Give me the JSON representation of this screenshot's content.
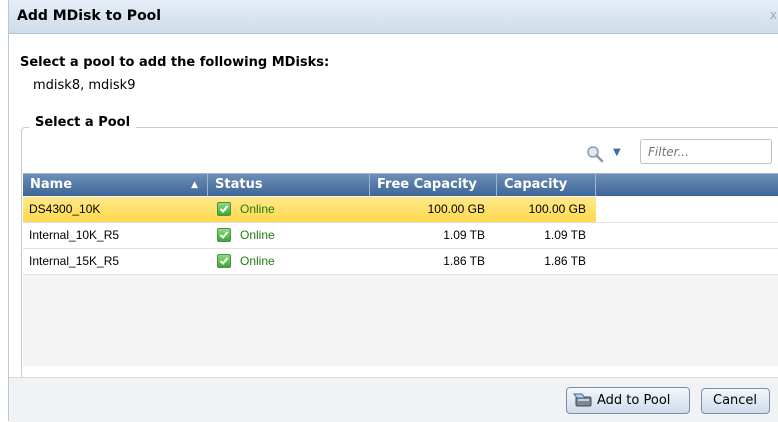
{
  "dialog": {
    "title": "Add MDisk to Pool",
    "close_glyph": "x",
    "heading": "Select a pool to add the following MDisks:",
    "mdisks": "mdisk8, mdisk9",
    "section_label": "Select a Pool"
  },
  "toolbar": {
    "search_icon": "magnifier-icon",
    "filter_placeholder": "Filter..."
  },
  "table": {
    "columns": [
      "Name",
      "Status",
      "Free Capacity",
      "Capacity"
    ],
    "sort": {
      "column": "Name",
      "direction": "ascending"
    },
    "rows": [
      {
        "name": "DS4300_10K",
        "status": "Online",
        "free": "100.00 GB",
        "capacity": "100.00 GB",
        "selected": true
      },
      {
        "name": "Internal_10K_R5",
        "status": "Online",
        "free": "1.09 TB",
        "capacity": "1.09 TB",
        "selected": false
      },
      {
        "name": "Internal_15K_R5",
        "status": "Online",
        "free": "1.86 TB",
        "capacity": "1.86 TB",
        "selected": false
      }
    ]
  },
  "buttons": {
    "add_to_pool": "Add to Pool",
    "cancel": "Cancel"
  },
  "colors": {
    "header_blue": "#4a6f9d",
    "selected_row": "#ffe070",
    "status_green": "#1f7a17"
  }
}
